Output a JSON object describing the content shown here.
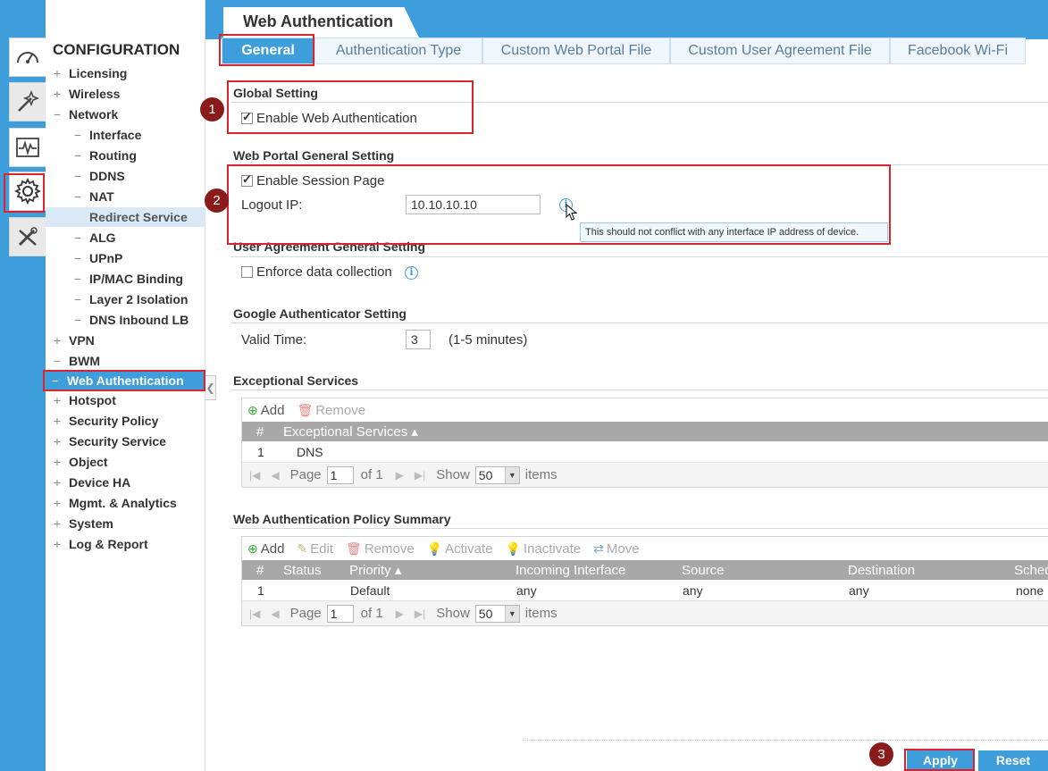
{
  "page": {
    "title": "Web Authentication"
  },
  "menu": {
    "title": "CONFIGURATION",
    "items": [
      {
        "toggle": "+",
        "label": "Licensing"
      },
      {
        "toggle": "+",
        "label": "Wireless"
      },
      {
        "toggle": "−",
        "label": "Network"
      },
      {
        "toggle": "−",
        "label": "Interface"
      },
      {
        "toggle": "−",
        "label": "Routing"
      },
      {
        "toggle": "−",
        "label": "DDNS"
      },
      {
        "toggle": "−",
        "label": "NAT"
      },
      {
        "toggle": "",
        "label": "Redirect Service"
      },
      {
        "toggle": "−",
        "label": "ALG"
      },
      {
        "toggle": "−",
        "label": "UPnP"
      },
      {
        "toggle": "−",
        "label": "IP/MAC Binding"
      },
      {
        "toggle": "−",
        "label": "Layer 2 Isolation"
      },
      {
        "toggle": "−",
        "label": "DNS Inbound LB"
      },
      {
        "toggle": "+",
        "label": "VPN"
      },
      {
        "toggle": "−",
        "label": "BWM"
      },
      {
        "toggle": "−",
        "label": "Web Authentication"
      },
      {
        "toggle": "+",
        "label": "Hotspot"
      },
      {
        "toggle": "+",
        "label": "Security Policy"
      },
      {
        "toggle": "+",
        "label": "Security Service"
      },
      {
        "toggle": "+",
        "label": "Object"
      },
      {
        "toggle": "+",
        "label": "Device HA"
      },
      {
        "toggle": "+",
        "label": "Mgmt. & Analytics"
      },
      {
        "toggle": "+",
        "label": "System"
      },
      {
        "toggle": "+",
        "label": "Log & Report"
      }
    ]
  },
  "tabs": [
    "General",
    "Authentication Type",
    "Custom Web Portal File",
    "Custom User Agreement File",
    "Facebook Wi-Fi"
  ],
  "global_setting": {
    "title": "Global Setting",
    "enable_web_auth": "Enable Web Authentication"
  },
  "portal_setting": {
    "title": "Web Portal General Setting",
    "enable_session": "Enable Session Page",
    "logout_ip_label": "Logout IP:",
    "logout_ip_value": "10.10.10.10",
    "tooltip": "This should not conflict with any interface IP address of device."
  },
  "user_agreement": {
    "title": "User Agreement General Setting",
    "enforce": "Enforce data collection"
  },
  "google_auth": {
    "title": "Google Authenticator Setting",
    "valid_time_label": "Valid Time:",
    "valid_time_value": "3",
    "valid_time_unit": "(1-5 minutes)"
  },
  "exceptional": {
    "title": "Exceptional Services",
    "add": "Add",
    "remove": "Remove",
    "col_num": "#",
    "col_service": "Exceptional Services ▴",
    "rows": [
      {
        "num": "1",
        "service": "DNS"
      }
    ]
  },
  "policy": {
    "title": "Web Authentication Policy Summary",
    "add": "Add",
    "edit": "Edit",
    "remove": "Remove",
    "activate": "Activate",
    "inactivate": "Inactivate",
    "move": "Move",
    "cols": [
      "#",
      "Status",
      "Priority ▴",
      "Incoming Interface",
      "Source",
      "Destination",
      "Sched"
    ],
    "rows": [
      {
        "num": "1",
        "status": "",
        "priority": "Default",
        "incoming": "any",
        "source": "any",
        "destination": "any",
        "schedule": "none"
      }
    ]
  },
  "pager": {
    "page_label": "Page",
    "page_value": "1",
    "of_label": "of 1",
    "show_label": "Show",
    "show_value": "50",
    "items_label": "items"
  },
  "markers": [
    "1",
    "2",
    "3"
  ],
  "footer": {
    "apply": "Apply",
    "reset": "Reset"
  },
  "colors": {
    "accent": "#3d9edb",
    "highlight": "#d9232e",
    "marker": "#8b1a1a"
  }
}
